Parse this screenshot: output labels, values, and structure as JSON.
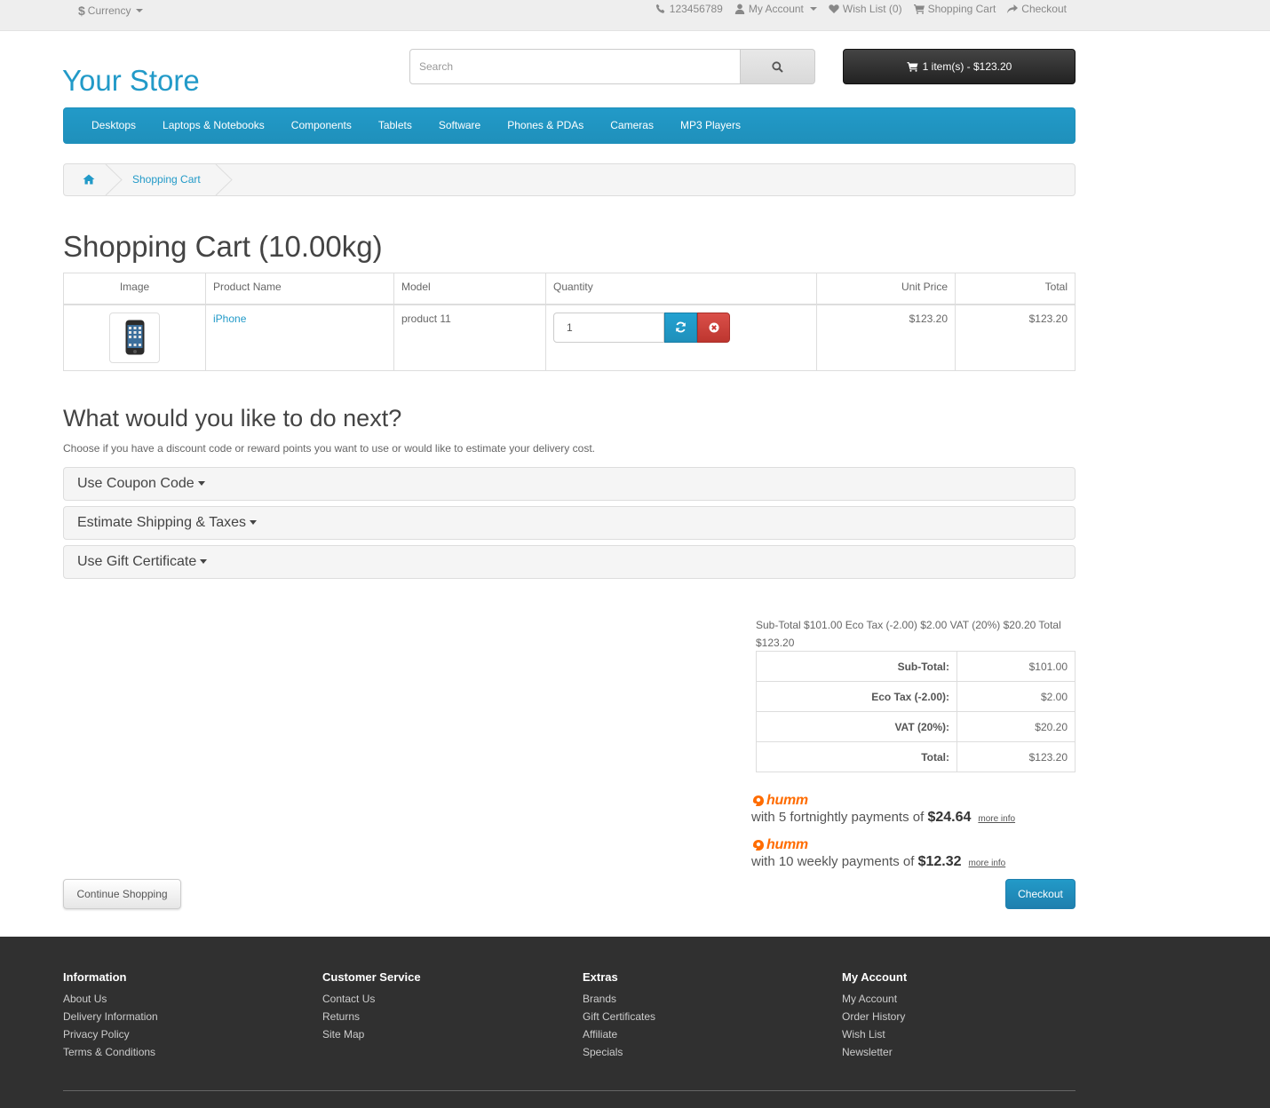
{
  "topbar": {
    "currency_symbol": "$",
    "currency_label": "Currency",
    "phone": "123456789",
    "my_account": "My Account",
    "wish_list": "Wish List (0)",
    "shopping_cart": "Shopping Cart",
    "checkout": "Checkout"
  },
  "header": {
    "logo": "Your Store",
    "search_placeholder": "Search",
    "cart_button": "1 item(s) - $123.20"
  },
  "menu": [
    "Desktops",
    "Laptops & Notebooks",
    "Components",
    "Tablets",
    "Software",
    "Phones & PDAs",
    "Cameras",
    "MP3 Players"
  ],
  "breadcrumb": {
    "current": "Shopping Cart"
  },
  "page_title": "Shopping Cart  (10.00kg)",
  "cart_table": {
    "headers": [
      "Image",
      "Product Name",
      "Model",
      "Quantity",
      "Unit Price",
      "Total"
    ],
    "rows": [
      {
        "product": "iPhone",
        "model": "product 11",
        "quantity": "1",
        "unit_price": "$123.20",
        "total": "$123.20"
      }
    ]
  },
  "next": {
    "heading": "What would you like to do next?",
    "description": "Choose if you have a discount code or reward points you want to use or would like to estimate your delivery cost.",
    "panels": [
      "Use Coupon Code",
      "Estimate Shipping & Taxes",
      "Use Gift Certificate"
    ]
  },
  "totals": {
    "summary_text": "Sub-Total $101.00 Eco Tax (-2.00) $2.00 VAT (20%) $20.20 Total $123.20",
    "rows": [
      {
        "label": "Sub-Total:",
        "value": "$101.00"
      },
      {
        "label": "Eco Tax (-2.00):",
        "value": "$2.00"
      },
      {
        "label": "VAT (20%):",
        "value": "$20.20"
      },
      {
        "label": "Total:",
        "value": "$123.20"
      }
    ]
  },
  "humm": [
    {
      "brand": "humm",
      "text": "with 5 fortnightly payments of ",
      "amount": "$24.64",
      "more": "more info"
    },
    {
      "brand": "humm",
      "text": "with 10 weekly payments of ",
      "amount": "$12.32",
      "more": "more info"
    }
  ],
  "buttons": {
    "continue": "Continue Shopping",
    "checkout": "Checkout"
  },
  "footer": {
    "columns": [
      {
        "title": "Information",
        "links": [
          "About Us",
          "Delivery Information",
          "Privacy Policy",
          "Terms & Conditions"
        ]
      },
      {
        "title": "Customer Service",
        "links": [
          "Contact Us",
          "Returns",
          "Site Map"
        ]
      },
      {
        "title": "Extras",
        "links": [
          "Brands",
          "Gift Certificates",
          "Affiliate",
          "Specials"
        ]
      },
      {
        "title": "My Account",
        "links": [
          "My Account",
          "Order History",
          "Wish List",
          "Newsletter"
        ]
      }
    ]
  },
  "colors": {
    "accent": "#229ac8",
    "humm_orange": "#ff6c00",
    "danger": "#da4f49",
    "footer_bg": "#303030"
  }
}
